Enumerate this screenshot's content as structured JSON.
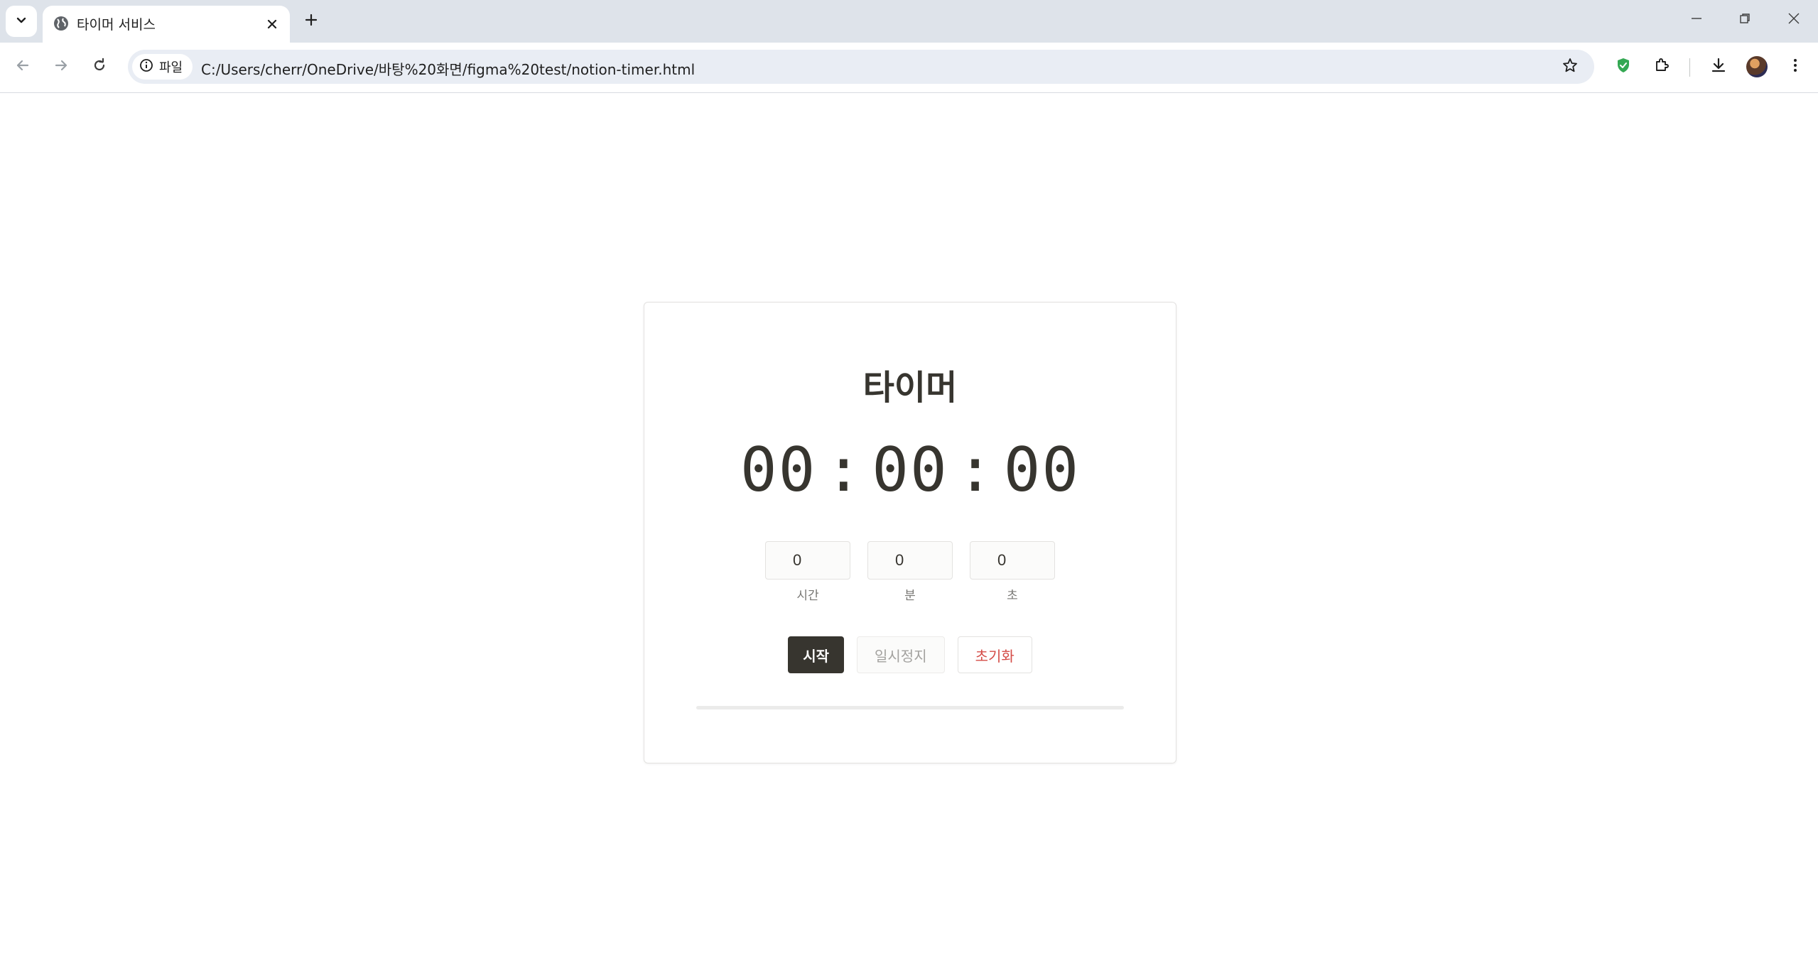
{
  "browser": {
    "tab": {
      "title": "타이머 서비스",
      "favicon": "globe-icon"
    },
    "omnibox": {
      "chip_label": "파일",
      "url": "C:/Users/cherr/OneDrive/바탕%20화면/figma%20test/notion-timer.html"
    },
    "icons": {
      "tab_search": "chevron-down-icon",
      "close_tab": "close-icon",
      "new_tab": "plus-icon",
      "minimize": "minimize-icon",
      "restore": "restore-icon",
      "close_window": "close-icon",
      "back": "arrow-left-icon",
      "forward": "arrow-right-icon",
      "reload": "reload-icon",
      "site_info": "info-icon",
      "bookmark": "star-icon",
      "shield_extension": "shield-icon",
      "extensions": "puzzle-icon",
      "downloads": "download-icon",
      "profile": "avatar",
      "menu": "more-vert-icon"
    },
    "colors": {
      "tabstrip_bg": "#dee3ea",
      "omnibox_bg": "#e9edf4",
      "shield_green": "#34a853"
    }
  },
  "timer": {
    "title": "타이머",
    "display": {
      "hours": "00",
      "minutes": "00",
      "seconds": "00",
      "separator": ":"
    },
    "inputs": [
      {
        "value": "0",
        "label": "시간"
      },
      {
        "value": "0",
        "label": "분"
      },
      {
        "value": "0",
        "label": "초"
      }
    ],
    "buttons": {
      "start": "시작",
      "pause": "일시정지",
      "reset": "초기화"
    },
    "progress": 0,
    "colors": {
      "text": "#37352f",
      "start_bg": "#37352f",
      "reset_text": "#d44c47",
      "muted": "#a3a29f"
    }
  }
}
